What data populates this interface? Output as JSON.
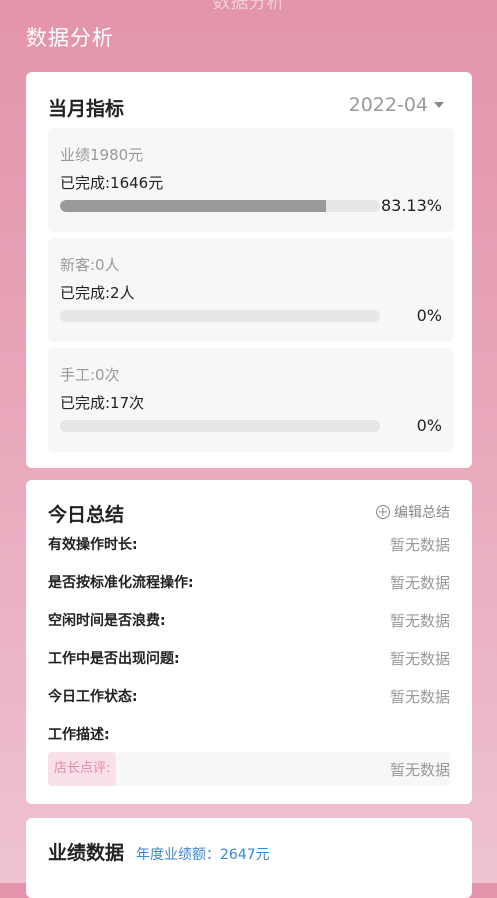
{
  "header": {
    "ghost_title": "数据分析",
    "title": "数据分析"
  },
  "month_card": {
    "title": "当月指标",
    "month": "2022-04",
    "metrics": [
      {
        "label": "业绩1980元",
        "done": "已完成:1646元",
        "percent_text": "83.13%",
        "progress": 0.8313
      },
      {
        "label": "新客:0人",
        "done": "已完成:2人",
        "percent_text": "0%",
        "progress": 0
      },
      {
        "label": "手工:0次",
        "done": "已完成:17次",
        "percent_text": "0%",
        "progress": 0
      }
    ]
  },
  "today_card": {
    "title": "今日总结",
    "edit_label": "编辑总结",
    "rows": [
      {
        "key": "有效操作时长:",
        "value": "暂无数据"
      },
      {
        "key": "是否按标准化流程操作:",
        "value": "暂无数据"
      },
      {
        "key": "空闲时间是否浪费:",
        "value": "暂无数据"
      },
      {
        "key": "工作中是否出现问题:",
        "value": "暂无数据"
      },
      {
        "key": "今日工作状态:",
        "value": "暂无数据"
      },
      {
        "key": "工作描述:",
        "value": ""
      }
    ],
    "review_label": "店长点评:",
    "review_value": "暂无数据"
  },
  "perf_card": {
    "title": "业绩数据",
    "annual": "年度业绩额：2647元"
  }
}
